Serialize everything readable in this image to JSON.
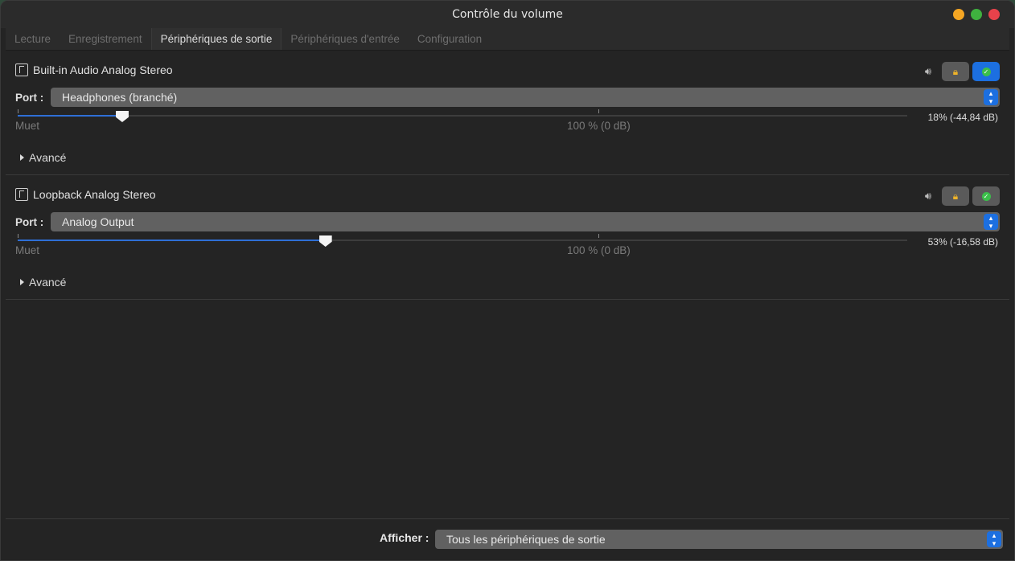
{
  "window": {
    "title": "Contrôle du volume"
  },
  "tabs": [
    {
      "label": "Lecture",
      "active": false
    },
    {
      "label": "Enregistrement",
      "active": false
    },
    {
      "label": "Périphériques de sortie",
      "active": true
    },
    {
      "label": "Périphériques d'entrée",
      "active": false
    },
    {
      "label": "Configuration",
      "active": false
    }
  ],
  "devices": [
    {
      "name": "Built-in Audio Analog Stereo",
      "port_label": "Port :",
      "port_value": "Headphones (branché)",
      "volume_percent": 18,
      "volume_text": "18% (-44,84 dB)",
      "mute_label": "Muet",
      "center_label": "100 % (0 dB)",
      "advanced_label": "Avancé",
      "default_active": true
    },
    {
      "name": "Loopback Analog Stereo",
      "port_label": "Port :",
      "port_value": "Analog Output",
      "volume_percent": 53,
      "volume_text": "53% (-16,58 dB)",
      "mute_label": "Muet",
      "center_label": "100 % (0 dB)",
      "advanced_label": "Avancé",
      "default_active": false
    }
  ],
  "footer": {
    "show_label": "Afficher :",
    "show_value": "Tous les périphériques de sortie"
  },
  "colors": {
    "accent": "#1c6fe0",
    "background": "#242424",
    "lock": "#f0b429"
  }
}
